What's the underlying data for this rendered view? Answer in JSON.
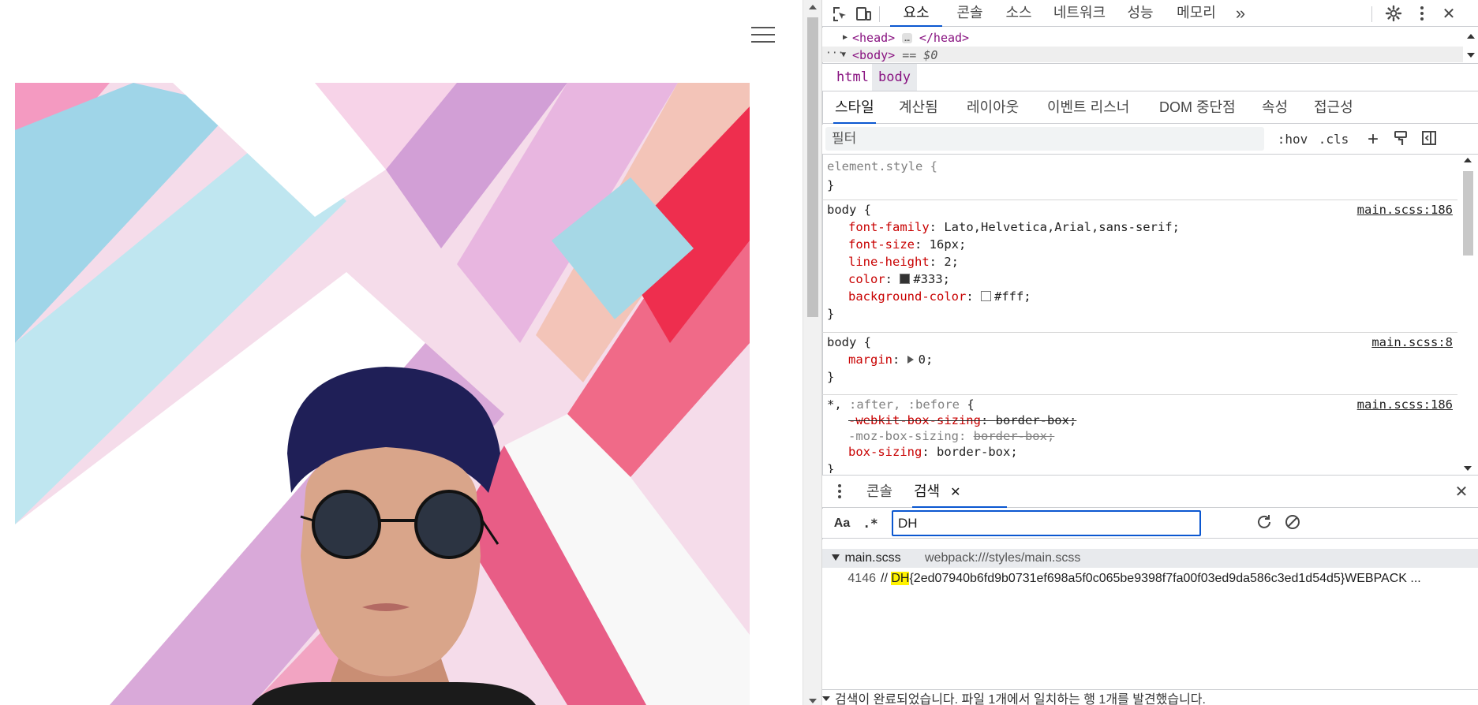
{
  "page": {
    "menu_icon": "hamburger-icon",
    "hero_alt": "photo"
  },
  "devtools": {
    "toolbar": {
      "inspect_icon": "inspect-element-icon",
      "device_icon": "device-toolbar-icon",
      "tabs": [
        "요소",
        "콘솔",
        "소스",
        "네트워크",
        "성능",
        "메모리"
      ],
      "more_tabs": "»",
      "settings_icon": "gear-icon",
      "menu_icon": "kebab-menu-icon",
      "close": "✕"
    },
    "dom": {
      "head_open": "<head>",
      "head_ellipsis": "…",
      "head_close": "</head>",
      "body_open": "<body>",
      "body_eq": "== $0",
      "row_ellipsis": "···"
    },
    "breadcrumbs": [
      "html",
      "body"
    ],
    "style_tabs": [
      "스타일",
      "계산됨",
      "레이아웃",
      "이벤트 리스너",
      "DOM 중단점",
      "속성",
      "접근성"
    ],
    "filter": {
      "placeholder": "필터",
      "hov": ":hov",
      "cls": ".cls",
      "add": "+",
      "paint_icon": "paint-brush-icon",
      "sidebar_icon": "toggle-sidebar-icon"
    },
    "rules": [
      {
        "selector": "element.style {",
        "close": "}"
      },
      {
        "selector": "body {",
        "source": "main.scss:186",
        "props": [
          {
            "name": "font-family",
            "value": "Lato,Helvetica,Arial,sans-serif;"
          },
          {
            "name": "font-size",
            "value": "16px;"
          },
          {
            "name": "line-height",
            "value": "2;"
          },
          {
            "name": "color",
            "value": "#333;",
            "swatch": "#333333"
          },
          {
            "name": "background-color",
            "value": "#fff;",
            "swatch": "#ffffff"
          }
        ],
        "close": "}"
      },
      {
        "selector": "body {",
        "source": "main.scss:8",
        "props": [
          {
            "name": "margin",
            "value": "0;"
          }
        ],
        "close": "}"
      },
      {
        "selector_main": "*, ",
        "selector_dim": ":after, :before",
        "selector_brace": " {",
        "source": "main.scss:186",
        "props": [
          {
            "name": "-webkit-box-sizing",
            "value": "border-box;"
          },
          {
            "name": "-moz-box-sizing",
            "value": "border-box;"
          },
          {
            "name": "box-sizing",
            "value": "border-box;"
          }
        ],
        "close": "}"
      }
    ],
    "drawer": {
      "more_icon": "kebab-menu-icon",
      "tabs": [
        "콘솔",
        "검색"
      ],
      "tab_close": "✕",
      "close": "✕"
    },
    "search": {
      "match_case": "Aa",
      "regex": ".*",
      "query": "DH",
      "refresh_icon": "refresh-icon",
      "clear_icon": "clear-icon"
    },
    "results": {
      "file": "main.scss",
      "path": "webpack:///styles/main.scss",
      "line_no": "4146",
      "prefix": "// ",
      "match": "DH",
      "rest": "{2ed07940b6fd9b0731ef698a5f0c065be9398f7fa00f03ed9da586c3ed1d54d5}WEBPACK ..."
    },
    "status": "검색이 완료되었습니다. 파일 1개에서 일치하는 행 1개를 발견했습니다."
  }
}
